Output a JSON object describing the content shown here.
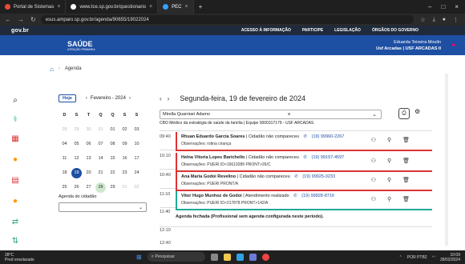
{
  "browser": {
    "tabs": [
      {
        "title": "Portal de Sistemas",
        "color": "#e74c3c"
      },
      {
        "title": "www.tce.sp.gov.br/questionario",
        "color": "#ffffff"
      },
      {
        "title": "PEC",
        "color": "#3aa0ff"
      }
    ],
    "url": "esus.amparo.sp.gov.br/agenda/90655/19022024"
  },
  "header": {
    "logo": "gov.br",
    "links": [
      "ACESSO À INFORMAÇÃO",
      "PARTICIPE",
      "LEGISLAÇÃO",
      "ÓRGÃOS DO GOVERNO"
    ],
    "brand": "SAÚDE",
    "brand_sub": "ATENÇÃO PRIMÁRIA",
    "user_name": "Eduarda Teixeira Moulin",
    "user_unit": "Usf Arcadas | USF ARCADAS II"
  },
  "breadcrumb": {
    "label": "Agenda"
  },
  "calendar": {
    "today_label": "Hoje",
    "month": "Fevereiro - 2024",
    "weekdays": [
      "D",
      "S",
      "T",
      "Q",
      "Q",
      "S",
      "S"
    ],
    "days": [
      [
        "28",
        "29",
        "30",
        "31",
        "01",
        "02",
        "03"
      ],
      [
        "04",
        "05",
        "06",
        "07",
        "08",
        "09",
        "10"
      ],
      [
        "11",
        "12",
        "13",
        "14",
        "15",
        "16",
        "17"
      ],
      [
        "18",
        "19",
        "20",
        "21",
        "22",
        "23",
        "24"
      ],
      [
        "25",
        "26",
        "27",
        "28",
        "29",
        "01",
        "02"
      ]
    ]
  },
  "agenda_cidadao": {
    "label": "Agenda do cidadão"
  },
  "main": {
    "day_title": "Segunda-feira, 19 de fevereiro de 2024",
    "professional": "Mirella Quarniari Adamo",
    "cbo": "CBO Médico da estratégia de saúde da família | Equipe 0000317179 - USF ARCADAS",
    "times": [
      "09:40",
      "10:10",
      "10:40",
      "11:10",
      "11:40",
      "12:10",
      "12:40"
    ],
    "appointments": [
      {
        "name": "Rhuan Eduardo Garcia Soares",
        "status": "Cidadão não compareceu",
        "phone": "(19) 99960-2267",
        "obs": "Observações: rotina criança"
      },
      {
        "name": "Helna Vitoria Lopes Barichello",
        "status": "Cidadão não compareceu",
        "phone": "(19) 99197-4597",
        "obs": "Observações: PUERI ID>16619289 PRONT>26/C"
      },
      {
        "name": "Ana Maria Godoi Revelino",
        "status": "Cidadão não compareceu",
        "phone": "(19) 99925-0233",
        "obs": "Observações: PUERI PRONT/A"
      },
      {
        "name": "Vitor Hugo Munhoz de Godoi",
        "status": "Atendimento realizado",
        "phone": "(19) 99828-8716",
        "obs": "Observações: PUERI ID>217878 PRONT>142/A"
      }
    ],
    "closed_note": "Agenda fechada (Profissional sem agenda configurada neste período)."
  },
  "taskbar": {
    "temp": "28°C",
    "weather": "Pred ensolarado",
    "search": "Pesquisar",
    "lang": "POR PTB2",
    "time": "10:09",
    "date": "28/02/2024"
  }
}
